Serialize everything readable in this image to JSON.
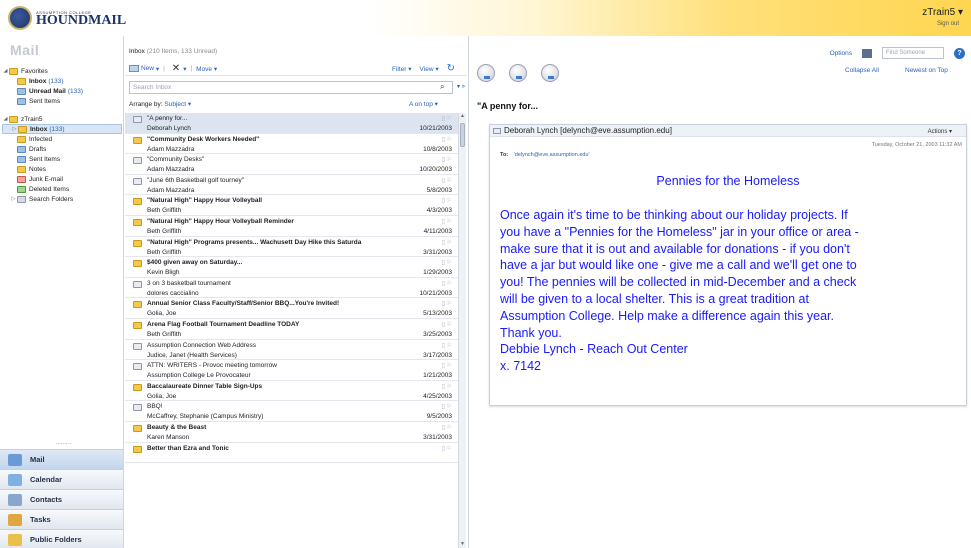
{
  "header": {
    "logo_small": "ASSUMPTION COLLEGE",
    "logo_big": "HOUNDMAIL",
    "user": "zTrain5 ▾",
    "sign_out": "Sign out"
  },
  "nav": {
    "title": "Mail",
    "tree": [
      {
        "label": "Favorites",
        "level": 0,
        "twisty": "◢",
        "icon": "favorites"
      },
      {
        "label": "Inbox",
        "count": "(133)",
        "level": 1,
        "bold": true,
        "icon": "inbox"
      },
      {
        "label": "Unread Mail",
        "count": "(133)",
        "level": 1,
        "bold": true,
        "icon": "unread"
      },
      {
        "label": "Sent Items",
        "level": 1,
        "icon": "sent"
      },
      {
        "label": "zTrain5",
        "level": 0,
        "twisty": "◢",
        "icon": "mailbox"
      },
      {
        "label": "Inbox",
        "count": "(133)",
        "level": 1,
        "bold": true,
        "selected": true,
        "twisty": "▷",
        "icon": "inbox"
      },
      {
        "label": "Infected",
        "level": 1,
        "icon": "folder"
      },
      {
        "label": "Drafts",
        "level": 1,
        "icon": "drafts"
      },
      {
        "label": "Sent Items",
        "level": 1,
        "icon": "sent"
      },
      {
        "label": "Notes",
        "level": 1,
        "icon": "notes"
      },
      {
        "label": "Junk E-mail",
        "level": 1,
        "icon": "junk"
      },
      {
        "label": "Deleted Items",
        "level": 1,
        "icon": "deleted"
      },
      {
        "label": "Search Folders",
        "level": 1,
        "twisty": "▷",
        "icon": "search-folder"
      }
    ],
    "dots": ".........",
    "buttons": [
      {
        "label": "Mail",
        "selected": true
      },
      {
        "label": "Calendar"
      },
      {
        "label": "Contacts"
      },
      {
        "label": "Tasks"
      },
      {
        "label": "Public Folders"
      }
    ]
  },
  "list": {
    "folder": "Inbox",
    "count_text": "(210 Items,  133 Unread)",
    "new_label": "New",
    "move_label": "Move",
    "filter_label": "Filter",
    "view_label": "View",
    "search_placeholder": "Search Inbox",
    "arrange_prefix": "Arrange by:",
    "arrange_value": "Subject ▾",
    "sort_order": "A on top",
    "messages": [
      {
        "subject": "\"A penny for...",
        "from": "Deborah Lynch",
        "date": "10/21/2003",
        "unread": false,
        "selected": true
      },
      {
        "subject": "\"Community Desk Workers Needed\"",
        "from": "Adam Mazzadra",
        "date": "10/8/2003",
        "unread": true
      },
      {
        "subject": "\"Community Desks\"",
        "from": "Adam Mazzadra",
        "date": "10/20/2003",
        "unread": false
      },
      {
        "subject": "\"June 6th Basketball golf tourney\"",
        "from": "Adam Mazzadra",
        "date": "5/8/2003",
        "unread": false
      },
      {
        "subject": "\"Natural High\" Happy Hour Volleyball",
        "from": "Beth Griffith",
        "date": "4/3/2003",
        "unread": true
      },
      {
        "subject": "\"Natural High\" Happy Hour Volleyball Reminder",
        "from": "Beth Griffith",
        "date": "4/11/2003",
        "unread": true
      },
      {
        "subject": "\"Natural High\" Programs presents... Wachusett Day Hike this Saturda",
        "from": "Beth Griffith",
        "date": "3/31/2003",
        "unread": true
      },
      {
        "subject": "$400 given away on Saturday...",
        "from": "Kevin Bligh",
        "date": "1/29/2003",
        "unread": true
      },
      {
        "subject": "3 on 3 basketball tournament",
        "from": "dolores caccialino",
        "date": "10/21/2003",
        "unread": false
      },
      {
        "subject": "Annual Senior Class Faculty/Staff/Senior BBQ...You're Invited!",
        "from": "Golia, Joe",
        "date": "5/13/2003",
        "unread": true
      },
      {
        "subject": "Arena Flag Football Tournament Deadline TODAY",
        "from": "Beth Griffith",
        "date": "3/25/2003",
        "unread": true
      },
      {
        "subject": "Assumption Connection Web Address",
        "from": "Judice, Janet (Health Services)",
        "date": "3/17/2003",
        "unread": false
      },
      {
        "subject": "ATTN: WRITERS - Provoc meeting tomorrow",
        "from": "Assumption College Le Provocateur",
        "date": "1/21/2003",
        "unread": false
      },
      {
        "subject": "Baccalaureate Dinner Table Sign-Ups",
        "from": "Golia, Joe",
        "date": "4/25/2003",
        "unread": true
      },
      {
        "subject": "BBQ!",
        "from": "McCaffrey, Stephanie (Campus Ministry)",
        "date": "9/5/2003",
        "unread": false
      },
      {
        "subject": "Beauty & the Beast",
        "from": "Karen Manson",
        "date": "3/31/2003",
        "unread": true
      },
      {
        "subject": "Better than Ezra and Tonic",
        "from": "",
        "date": "",
        "unread": true
      }
    ]
  },
  "reading": {
    "options": "Options",
    "find_placeholder": "Find Someone",
    "help": "?",
    "collapse_all": "Collapse All",
    "newest_on_top": "Newest on Top",
    "subject": "\"A penny for...",
    "sender": "Deborah Lynch [delynch@eve.assumption.edu]",
    "actions": "Actions ▾",
    "date": "Tuesday, October 21, 2003 11:32 AM",
    "to_label": "To:",
    "to_value": "'delynch@eve.assumption.edu'",
    "body_title": "Pennies for the Homeless",
    "body_lines": [
      "Once again it's time to be thinking about our holiday projects.  If",
      "you have a \"Pennies for the Homeless\" jar in your office or area -",
      "make sure that it is out and available for donations - if you don't",
      "have a jar but would like one - give me a call and we'll get one to",
      "you!  The pennies will be collected in mid-December and a check",
      "will be given to a local shelter.  This is a great tradition at",
      "Assumption College.  Help make a difference again this year.",
      "Thank you.",
      "Debbie Lynch - Reach Out Center",
      "x. 7142"
    ]
  }
}
